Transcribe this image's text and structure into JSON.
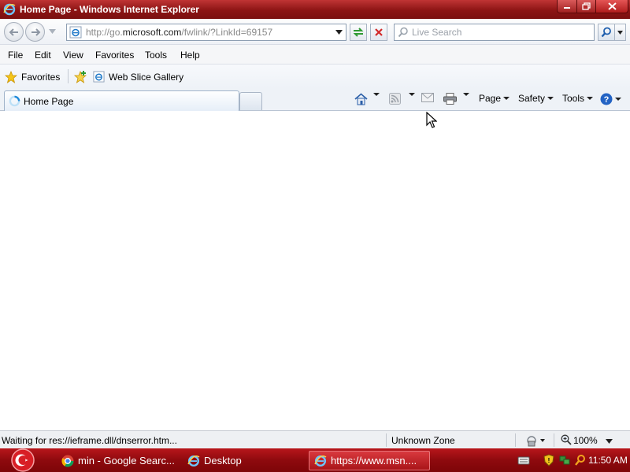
{
  "window": {
    "title": "Home Page - Windows Internet Explorer"
  },
  "address_bar": {
    "url_prefix": "http://go.",
    "url_domain": "microsoft.com",
    "url_suffix": "/fwlink/?LinkId=69157"
  },
  "search": {
    "placeholder": "Live Search"
  },
  "menu": {
    "items": [
      "File",
      "Edit",
      "View",
      "Favorites",
      "Tools",
      "Help"
    ]
  },
  "favorites_bar": {
    "favorites_label": "Favorites",
    "web_slice_label": "Web Slice Gallery"
  },
  "tabs": {
    "active_label": "Home Page"
  },
  "command_bar": {
    "page_label": "Page",
    "safety_label": "Safety",
    "tools_label": "Tools"
  },
  "status_bar": {
    "status_text": "Waiting for res://ieframe.dll/dnserror.htm...",
    "zone": "Unknown Zone",
    "zoom": "100%"
  },
  "taskbar": {
    "items": [
      {
        "label": "min - Google Searc...",
        "icon": "chrome-icon"
      },
      {
        "label": "Desktop",
        "icon": "ie-icon"
      },
      {
        "label": "https://www.msn....",
        "icon": "ie-icon"
      }
    ],
    "clock": "11:50 AM"
  },
  "colors": {
    "titlebar": "#8c1414",
    "taskbar": "#8e0a0e",
    "ie_blue": "#1e78c8"
  }
}
